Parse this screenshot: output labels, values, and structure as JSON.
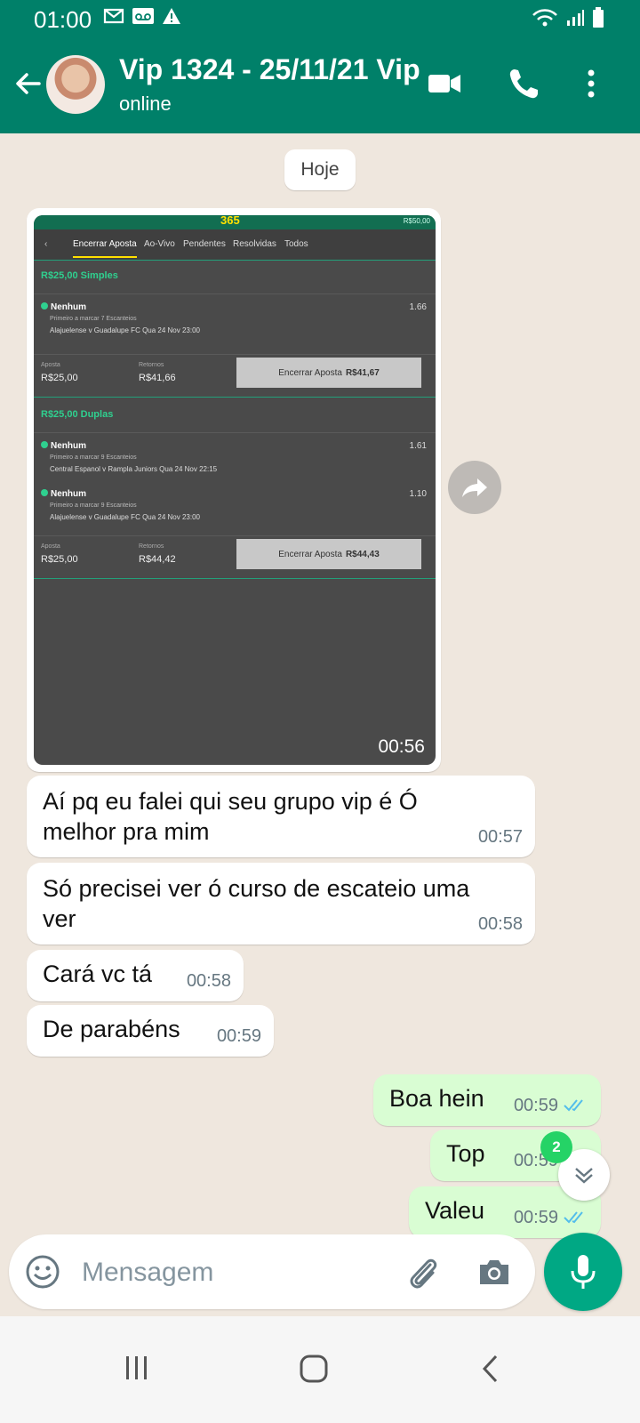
{
  "status_bar": {
    "time": "01:00",
    "notification_icons": [
      "gmail-icon",
      "voicemail-icon",
      "warning-icon"
    ],
    "system_icons": [
      "wifi-icon",
      "signal-icon",
      "battery-icon"
    ]
  },
  "header": {
    "title": "Vip 1324 - 25/11/21 Vip",
    "subtitle": "online",
    "icons": [
      "back-arrow-icon",
      "video-call-icon",
      "voice-call-icon",
      "more-vert-icon"
    ]
  },
  "chat": {
    "date_chip": "Hoje",
    "media": {
      "duration": "00:56",
      "screen": {
        "brand": "365",
        "balance": "R$50,00",
        "tabs": [
          "Encerrar Aposta",
          "Ao-Vivo",
          "Pendentes",
          "Resolvidas",
          "Todos"
        ],
        "bets": [
          {
            "header": "R$25,00 Simples",
            "selections": [
              {
                "name": "Nenhum",
                "odd": "1.66",
                "market": "Primeiro a marcar 7 Escanteios",
                "event": "Alajuelense v Guadalupe FC  Qua 24 Nov 23:00"
              }
            ],
            "stake_label": "Aposta",
            "stake": "R$25,00",
            "return_label": "Retornos",
            "return": "R$41,66",
            "cashout_label": "Encerrar Aposta",
            "cashout_value": "R$41,67"
          },
          {
            "header": "R$25,00 Duplas",
            "selections": [
              {
                "name": "Nenhum",
                "odd": "1.61",
                "market": "Primeiro a marcar 9 Escanteios",
                "event": "Central Espanol v Rampla Juniors  Qua 24 Nov 22:15"
              },
              {
                "name": "Nenhum",
                "odd": "1.10",
                "market": "Primeiro a marcar 9 Escanteios",
                "event": "Alajuelense v Guadalupe FC  Qua 24 Nov 23:00"
              }
            ],
            "stake_label": "Aposta",
            "stake": "R$25,00",
            "return_label": "Retornos",
            "return": "R$44,42",
            "cashout_label": "Encerrar Aposta",
            "cashout_value": "R$44,43"
          }
        ]
      }
    },
    "messages": [
      {
        "direction": "in",
        "lines": [
          "Aí pq eu falei qui seu grupo vip é Ó",
          "melhor pra mim"
        ],
        "time": "00:57"
      },
      {
        "direction": "in",
        "lines": [
          "Só precisei ver ó curso de escateio uma",
          "ver"
        ],
        "time": "00:58"
      },
      {
        "direction": "in",
        "lines": [
          "Cará vc tá"
        ],
        "time": "00:58"
      },
      {
        "direction": "in",
        "lines": [
          "De parabéns"
        ],
        "time": "00:59"
      },
      {
        "direction": "out",
        "lines": [
          "Boa hein"
        ],
        "time": "00:59",
        "status": "read"
      },
      {
        "direction": "out",
        "lines": [
          "Top"
        ],
        "time": "00:59",
        "status": "read"
      },
      {
        "direction": "out",
        "lines": [
          "Valeu"
        ],
        "time": "00:59",
        "status": "read"
      }
    ],
    "unread_badge": "2"
  },
  "composer": {
    "placeholder": "Mensagem"
  },
  "colors": {
    "primary": "#008069",
    "accent": "#00a884",
    "outgoing_bubble": "#d9fdd3",
    "chat_background": "#efe7de",
    "read_ticks": "#53bdeb"
  }
}
